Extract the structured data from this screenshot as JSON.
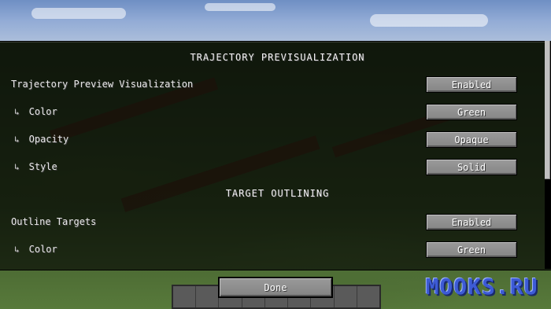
{
  "sections": [
    {
      "title": "TRAJECTORY PREVISUALIZATION"
    },
    {
      "title": "TARGET OUTLINING"
    }
  ],
  "options": [
    {
      "label": "Trajectory Preview Visualization",
      "sub": false,
      "value": "Enabled"
    },
    {
      "label": "Color",
      "sub": true,
      "value": "Green"
    },
    {
      "label": "Opacity",
      "sub": true,
      "value": "Opaque"
    },
    {
      "label": "Style",
      "sub": true,
      "value": "Solid"
    },
    {
      "label": "Outline Targets",
      "sub": false,
      "value": "Enabled"
    },
    {
      "label": "Color",
      "sub": true,
      "value": "Green"
    }
  ],
  "sub_arrow": "↳",
  "done_label": "Done",
  "watermark": "MOOKS.RU",
  "colors": {
    "panel": "#000000",
    "button": "#8f8f8f",
    "watermark": "#3d5bd6"
  }
}
